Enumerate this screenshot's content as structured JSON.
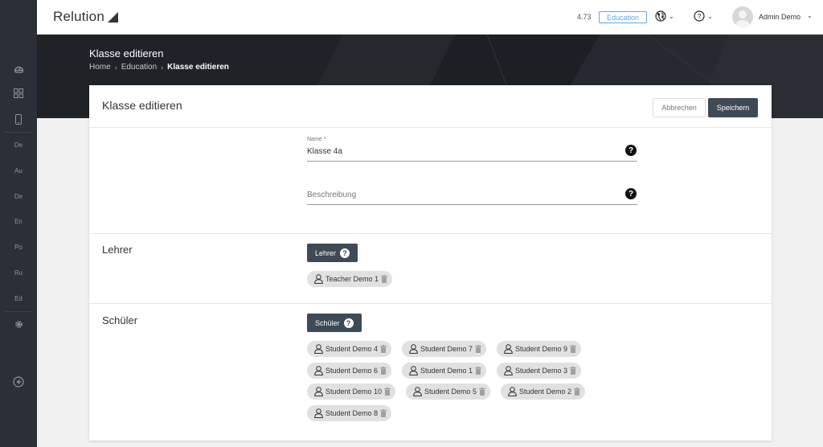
{
  "sidebar": {
    "items": [
      {
        "icon": "dashboard-icon"
      },
      {
        "icon": "apps-grid-icon"
      },
      {
        "icon": "device-icon"
      },
      {
        "label": "De"
      },
      {
        "label": "Au"
      },
      {
        "label": "De"
      },
      {
        "label": "En"
      },
      {
        "label": "Po"
      },
      {
        "label": "Ru"
      },
      {
        "label": "Ed"
      },
      {
        "icon": "settings-icon"
      },
      {
        "icon": "back-icon"
      }
    ]
  },
  "topbar": {
    "logo": "Relution",
    "version": "4.73",
    "edition_badge": "Education",
    "user_name": "Admin Demo"
  },
  "header": {
    "title": "Klasse editieren",
    "breadcrumb": [
      "Home",
      "Education",
      "Klasse editieren"
    ]
  },
  "card": {
    "title": "Klasse editieren",
    "cancel_label": "Abbrechen",
    "save_label": "Speichern",
    "name_label": "Name *",
    "name_value": "Klasse 4a",
    "description_placeholder": "Beschreibung",
    "teachers": {
      "section_label": "Lehrer",
      "button_label": "Lehrer",
      "chips": [
        "Teacher Demo 1"
      ]
    },
    "students": {
      "section_label": "Schüler",
      "button_label": "Schüler",
      "chips": [
        "Student Demo 4",
        "Student Demo 7",
        "Student Demo 9",
        "Student Demo 6",
        "Student Demo 1",
        "Student Demo 3",
        "Student Demo 10",
        "Student Demo 5",
        "Student Demo 2",
        "Student Demo 8"
      ]
    }
  },
  "colors": {
    "sidebar_bg": "#2b3038",
    "header_bg": "#1f2226",
    "primary_button": "#3e4a55",
    "badge_blue": "#5aa8e6",
    "chip_bg": "#e1e1e1"
  }
}
